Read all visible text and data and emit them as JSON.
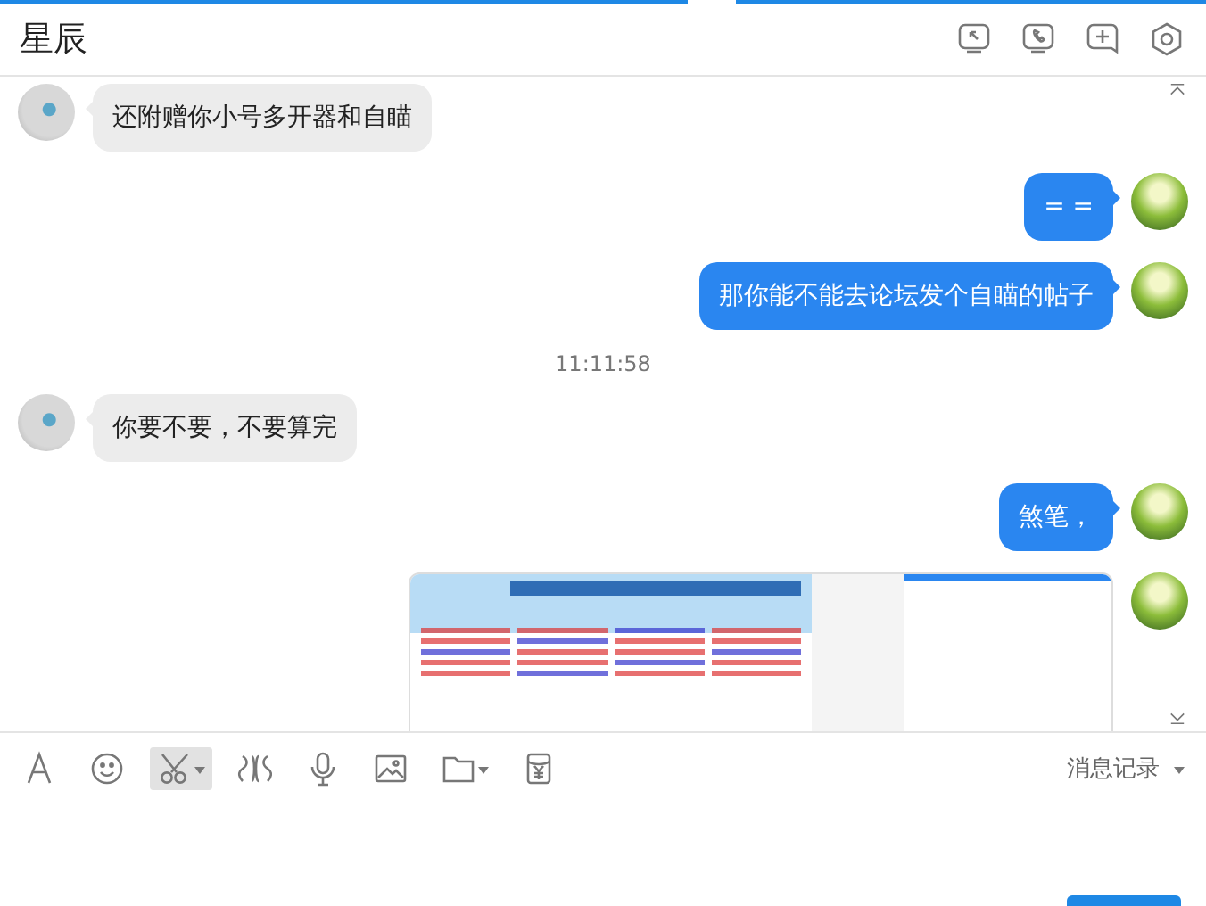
{
  "chat": {
    "title": "星辰"
  },
  "header_buttons": [
    {
      "kind": "screen-share"
    },
    {
      "kind": "call"
    },
    {
      "kind": "add"
    },
    {
      "kind": "settings"
    }
  ],
  "messages": [
    {
      "kind": "received",
      "text": "还附赠你小号多开器和自瞄"
    },
    {
      "kind": "sent",
      "text": "= ="
    },
    {
      "kind": "sent",
      "text": "那你能不能去论坛发个自瞄的帖子"
    },
    {
      "kind": "time",
      "text": "11:11:58"
    },
    {
      "kind": "received",
      "text": "你要不要，不要算完"
    },
    {
      "kind": "sent",
      "text": "煞笔，"
    },
    {
      "kind": "sent-image"
    }
  ],
  "toolbar": [
    {
      "kind": "font",
      "selected": false,
      "dropdown": false
    },
    {
      "kind": "emoji",
      "selected": false,
      "dropdown": false
    },
    {
      "kind": "screenshot",
      "selected": true,
      "dropdown": true
    },
    {
      "kind": "shake",
      "selected": false,
      "dropdown": false
    },
    {
      "kind": "voice",
      "selected": false,
      "dropdown": false
    },
    {
      "kind": "image",
      "selected": false,
      "dropdown": false
    },
    {
      "kind": "file",
      "selected": false,
      "dropdown": true
    },
    {
      "kind": "red-packet",
      "selected": false,
      "dropdown": false
    }
  ],
  "history": {
    "label": "消息记录"
  }
}
